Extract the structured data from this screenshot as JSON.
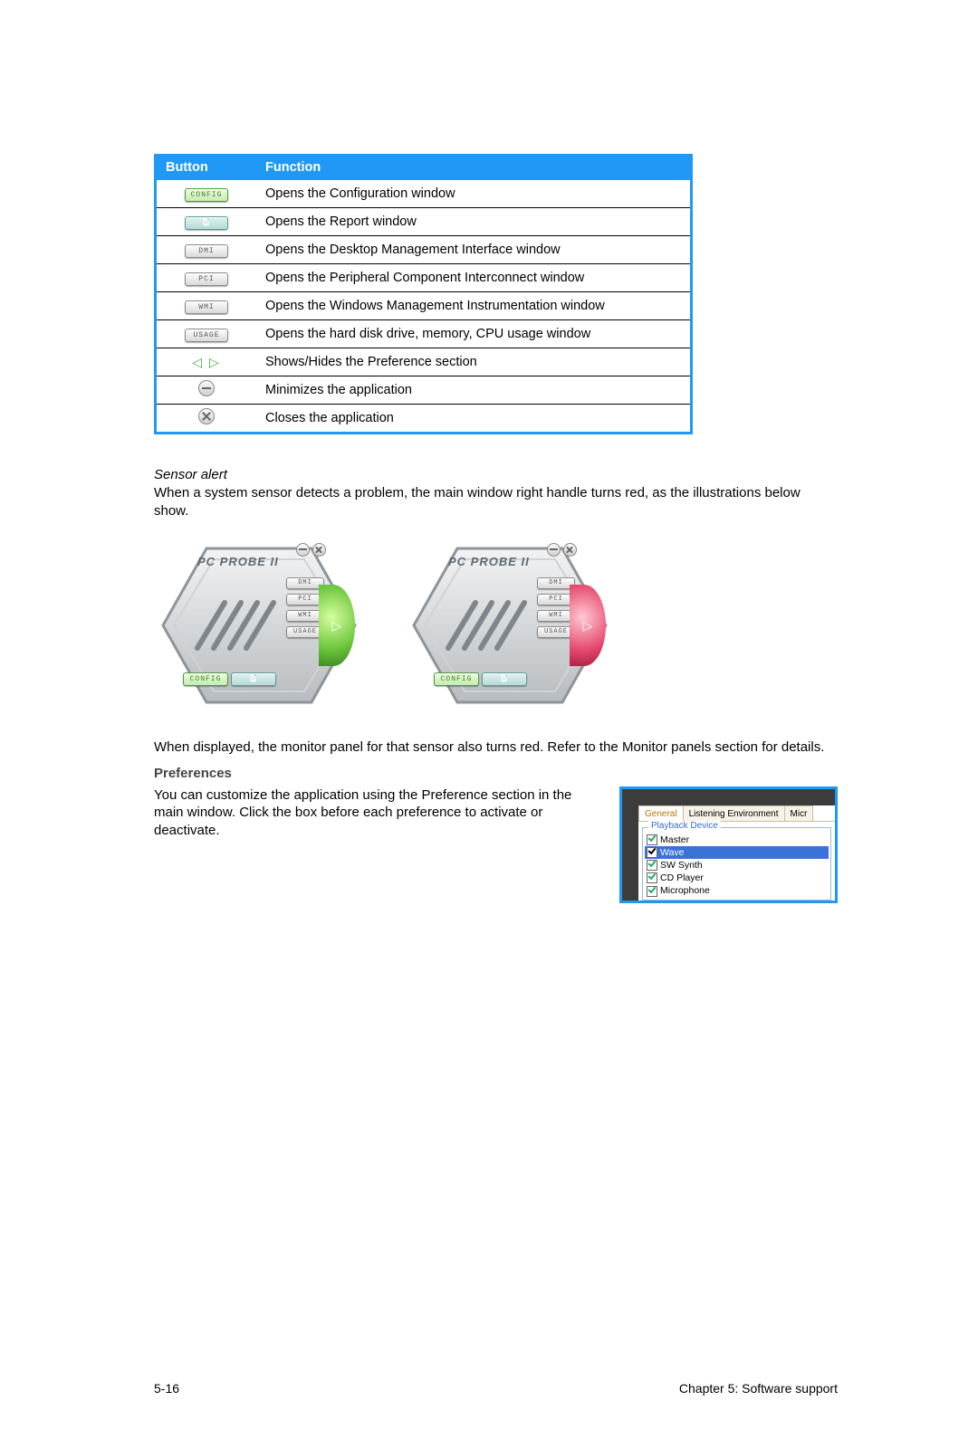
{
  "table": {
    "head_button": "Button",
    "head_function": "Function",
    "rows": [
      {
        "btn": "CONFIG",
        "btn_variant": "green",
        "func": "Opens the Configuration window"
      },
      {
        "btn": "📄",
        "btn_variant": "teal",
        "func": "Opens the Report window"
      },
      {
        "btn": "DMI",
        "btn_variant": "",
        "func": "Opens the Desktop Management Interface window"
      },
      {
        "btn": "PCI",
        "btn_variant": "",
        "func": "Opens the Peripheral Component Interconnect window"
      },
      {
        "btn": "WMI",
        "btn_variant": "",
        "func": "Opens the Windows Management Instrumentation window"
      },
      {
        "btn": "USAGE",
        "btn_variant": "",
        "func": "Opens the hard disk drive, memory, CPU usage window"
      },
      {
        "btn": "◁ ▷",
        "btn_variant": "arrows",
        "func": "Shows/Hides the Preference section"
      },
      {
        "btn": "minus",
        "btn_variant": "round",
        "func": "Minimizes the application"
      },
      {
        "btn": "close",
        "btn_variant": "round",
        "func": "Closes the application"
      }
    ]
  },
  "sensor": {
    "heading": "Sensor alert",
    "para": "When a system sensor detects a problem, the main window right handle turns red, as the illustrations below show.",
    "probe_title": "PC PROBE II",
    "side_buttons": [
      "DMI",
      "PCI",
      "WMI",
      "USAGE"
    ],
    "bottom_button": "CONFIG",
    "note": "When displayed, the monitor panel for that sensor also turns red. Refer to the Monitor panels section for details."
  },
  "prefs": {
    "heading": "Preferences",
    "para": "You can customize the application using the Preference section in the main window. Click the box before each preference to activate or deactivate.",
    "tabs": [
      "General",
      "Listening Environment",
      "Micr"
    ],
    "group": "Playback Device",
    "items": [
      {
        "label": "Master",
        "sel": false
      },
      {
        "label": "Wave",
        "sel": true
      },
      {
        "label": "SW Synth",
        "sel": false
      },
      {
        "label": "CD Player",
        "sel": false
      },
      {
        "label": "Microphone",
        "sel": false
      }
    ]
  },
  "footer": {
    "left": "5-16",
    "right": "Chapter 5: Software support"
  }
}
